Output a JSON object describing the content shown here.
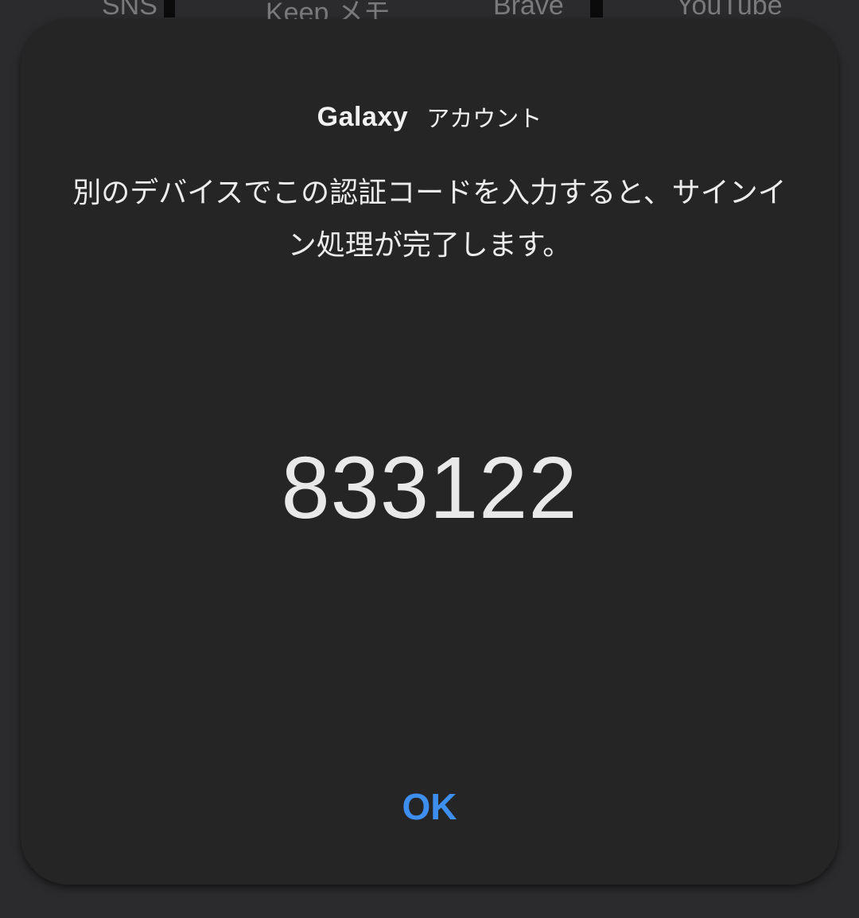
{
  "background": {
    "apps": [
      {
        "label": "SNS"
      },
      {
        "label": "Keep メモ"
      },
      {
        "label": "Brave"
      },
      {
        "label": "YouTube"
      }
    ]
  },
  "dialog": {
    "brand_logo": "Galaxy",
    "brand_text": "アカウント",
    "message": "別のデバイスでこの認証コードを入力すると、サインイン処理が完了します。",
    "code": "833122",
    "ok_label": "OK"
  },
  "colors": {
    "background": "#2b2b2d",
    "dialog": "#252525",
    "accent": "#3e8ef0",
    "text": "#ececec"
  }
}
